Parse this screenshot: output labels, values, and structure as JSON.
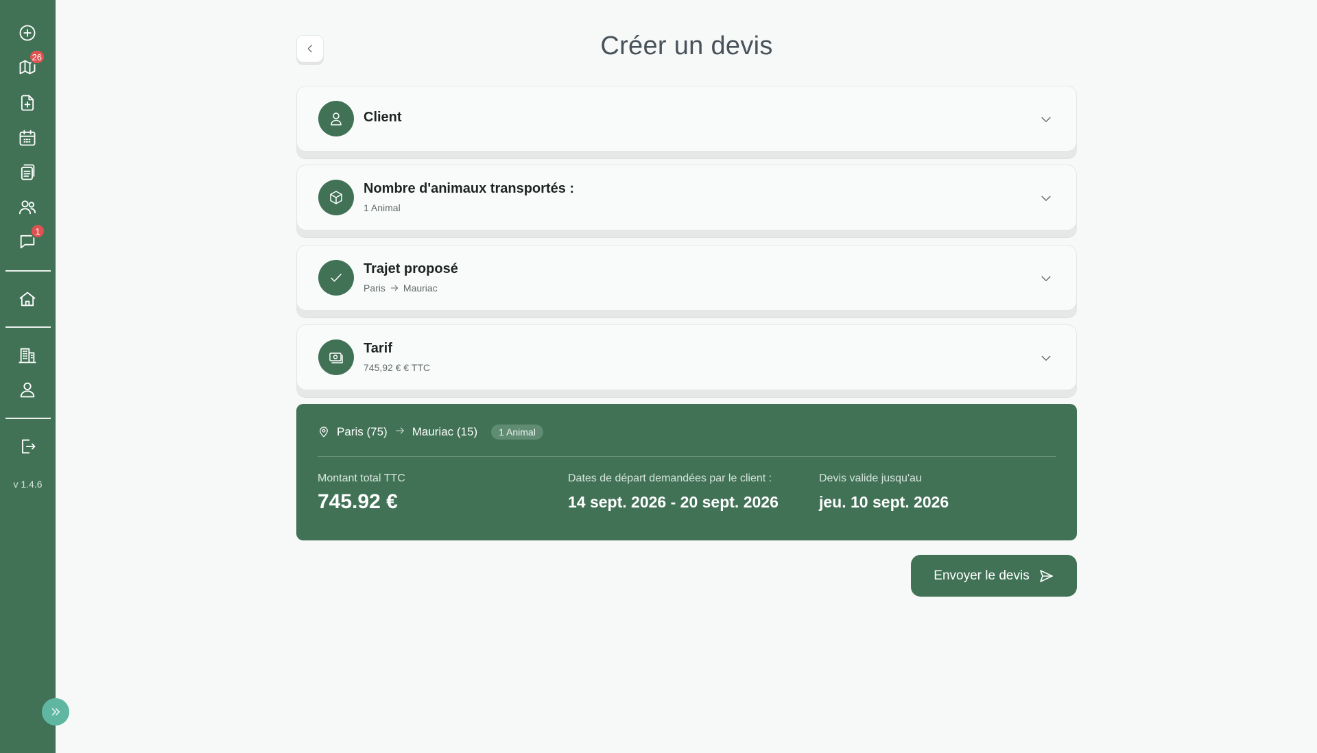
{
  "sidebar": {
    "items": [
      {
        "icon": "plus-circle-icon",
        "badge": ""
      },
      {
        "icon": "map-icon",
        "badge": "26"
      },
      {
        "icon": "file-plus-icon",
        "badge": ""
      },
      {
        "icon": "calendar-icon",
        "badge": ""
      },
      {
        "icon": "documents-icon",
        "badge": ""
      },
      {
        "icon": "users-icon",
        "badge": ""
      },
      {
        "icon": "chat-icon",
        "badge": "1"
      },
      {
        "icon": "home-icon",
        "badge": ""
      },
      {
        "icon": "building-icon",
        "badge": ""
      },
      {
        "icon": "user-icon",
        "badge": ""
      },
      {
        "icon": "logout-icon",
        "badge": ""
      }
    ],
    "version": "v 1.4.6",
    "accent": "#417256"
  },
  "header": {
    "title": "Créer un devis"
  },
  "sections": {
    "client": {
      "title": "Client"
    },
    "animals": {
      "title": "Nombre d'animaux transportés :",
      "sub": "1 Animal"
    },
    "trip": {
      "title": "Trajet proposé",
      "from": "Paris",
      "to": "Mauriac"
    },
    "price": {
      "title": "Tarif",
      "sub": "745,92 € € TTC"
    }
  },
  "summary": {
    "from": "Paris (75)",
    "to": "Mauriac (15)",
    "animals_pill": "1 Animal",
    "total_label": "Montant total TTC",
    "total_value": "745.92 €",
    "dates_label": "Dates de départ demandées par le client :",
    "dates_value": "14 sept. 2026 - 20 sept. 2026",
    "valid_label": "Devis valide jusqu'au",
    "valid_value": "jeu. 10 sept. 2026"
  },
  "actions": {
    "send_label": "Envoyer le devis"
  }
}
